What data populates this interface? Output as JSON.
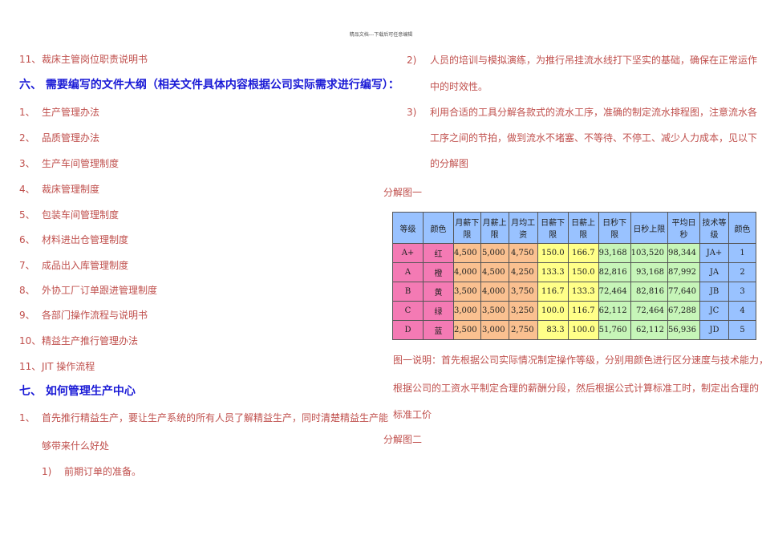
{
  "header": "精品文档---下载后可任意编辑",
  "left": {
    "first": {
      "num": "11、",
      "text": "裁床主管岗位职责说明书"
    },
    "heading6": "六、 需要编写的文件大纲（相关文件具体内容根据公司实际需求进行编写）：",
    "list6": [
      {
        "num": "1、",
        "text": "生产管理办法"
      },
      {
        "num": "2、",
        "text": "品质管理办法"
      },
      {
        "num": "3、",
        "text": "生产车间管理制度"
      },
      {
        "num": "4、",
        "text": "裁床管理制度"
      },
      {
        "num": "5、",
        "text": "包装车间管理制度"
      },
      {
        "num": "6、",
        "text": "材料进出仓管理制度"
      },
      {
        "num": "7、",
        "text": "成品出入库管理制度"
      },
      {
        "num": "8、",
        "text": "外协工厂订单跟进管理制度"
      },
      {
        "num": "9、",
        "text": "各部门操作流程与说明书"
      },
      {
        "num": "10、",
        "text": "精益生产推行管理办法"
      },
      {
        "num": "11、",
        "text": "JIT 操作流程"
      }
    ],
    "heading7": "七、 如何管理生产中心",
    "item7_1": {
      "num": "1、",
      "line1": "首先推行精益生产，要让生产系统的所有人员了解精益生产，同时清楚精益生产能",
      "line2": "够带来什么好处"
    },
    "sub1": {
      "num": "1)",
      "text": "前期订单的准备。"
    }
  },
  "right": {
    "item2": {
      "num": "2)",
      "line1": "人员的培训与模拟演练，为推行吊挂流水线打下坚实的基础，确保在正常运作",
      "line2": "中的时效性。"
    },
    "item3": {
      "num": "3)",
      "line1": "利用合适的工具分解各款式的流水工序，准确的制定流水排程图，注意流水各",
      "line2": "工序之间的节拍，做到流水不堵塞、不等待、不停工、减少人力成本，见以下",
      "line3": "的分解图"
    },
    "fig1": "分解图一",
    "caption": [
      "图一说明：首先根据公司实际情况制定操作等级，分别用颜色进行区分速度与技术能力，",
      "根据公司的工资水平制定合理的薪酬分段，然后根据公式计算标准工时，制定出合理的",
      "标准工价"
    ],
    "fig2": "分解图二"
  },
  "table": {
    "headers": [
      "等级",
      "颜色",
      "月薪下限",
      "月薪上限",
      "月均工资",
      "日薪下限",
      "日薪上限",
      "日秒下限",
      "日秒上限",
      "平均日秒",
      "技术等级",
      "颜色"
    ],
    "rows": [
      [
        "A+",
        "红",
        "4,500",
        "5,000",
        "4,750",
        "150.0",
        "166.7",
        "93,168",
        "103,520",
        "98,344",
        "JA+",
        "1"
      ],
      [
        "A",
        "橙",
        "4,000",
        "4,500",
        "4,250",
        "133.3",
        "150.0",
        "82,816",
        "93,168",
        "87,992",
        "JA",
        "2"
      ],
      [
        "B",
        "黄",
        "3,500",
        "4,000",
        "3,750",
        "116.7",
        "133.3",
        "72,464",
        "82,816",
        "77,640",
        "JB",
        "3"
      ],
      [
        "C",
        "绿",
        "3,000",
        "3,500",
        "3,250",
        "100.0",
        "116.7",
        "62,112",
        "72,464",
        "67,288",
        "JC",
        "4"
      ],
      [
        "D",
        "蓝",
        "2,500",
        "3,000",
        "2,750",
        "83.3",
        "100.0",
        "51,760",
        "62,112",
        "56,936",
        "JD",
        "5"
      ]
    ]
  }
}
